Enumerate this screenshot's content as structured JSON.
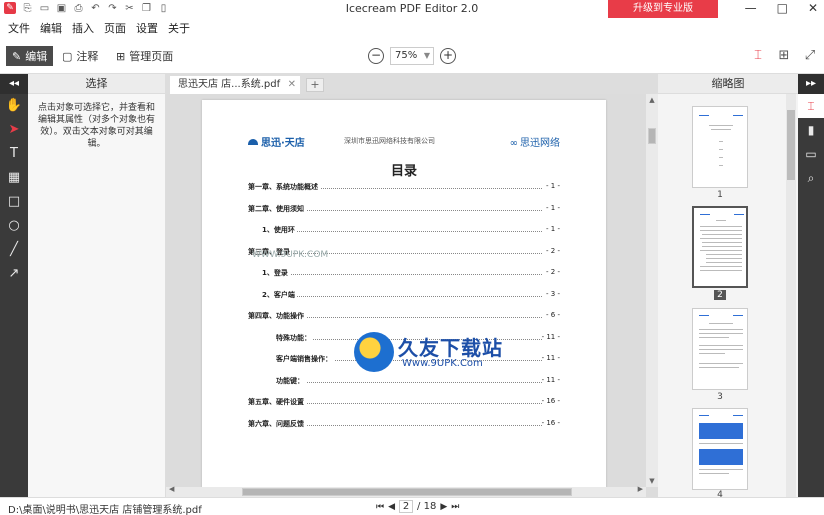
{
  "window": {
    "title": "Icecream PDF Editor 2.0",
    "upgrade_label": "升级到专业版",
    "minimize": "—",
    "maximize": "□",
    "close": "✕"
  },
  "menu": [
    "文件",
    "编辑",
    "插入",
    "页面",
    "设置",
    "关于"
  ],
  "toolbar": {
    "edit_label": "编辑",
    "annotate_label": "注释",
    "manage_label": "管理页面",
    "zoom_value": "75%"
  },
  "left_panel": {
    "collapse": "◂◂",
    "title": "选择",
    "description": "点击对象可选择它，并查看和编辑其属性（对多个对象也有效）。双击文本对象可对其编辑。",
    "tools": [
      "hand-icon",
      "select-arrow-icon",
      "text-tool-icon",
      "image-tool-icon",
      "rectangle-tool-icon",
      "ellipse-tool-icon",
      "line-tool-icon",
      "arrow-tool-icon"
    ]
  },
  "tab": {
    "name": "思迅天店 店...系统.pdf",
    "close": "✕",
    "add": "+"
  },
  "document": {
    "logo_left": "思迅·天店",
    "company": "深圳市思迅网络科技有限公司",
    "logo_right": "思迅网络",
    "toc_title": "目录",
    "toc": [
      {
        "title": "第一章、系统功能概述",
        "page": "- 1 -",
        "indent": 0
      },
      {
        "title": "第二章、使用须知",
        "page": "- 1 -",
        "indent": 0
      },
      {
        "title": "1、使用环",
        "page": "- 1 -",
        "indent": 1
      },
      {
        "title": "第三章、登录",
        "page": "- 2 -",
        "indent": 0
      },
      {
        "title": "1、登录",
        "page": "- 2 -",
        "indent": 1
      },
      {
        "title": "2、客户端",
        "page": "- 3 -",
        "indent": 1
      },
      {
        "title": "第四章、功能操作",
        "page": "- 6 -",
        "indent": 0
      },
      {
        "title": "特殊功能：",
        "page": "- 11 -",
        "indent": 2
      },
      {
        "title": "客户端销售操作：",
        "page": "- 11 -",
        "indent": 2
      },
      {
        "title": "功能键：",
        "page": "- 11 -",
        "indent": 2
      },
      {
        "title": "第五章、硬件设置",
        "page": "- 16 -",
        "indent": 0
      },
      {
        "title": "第六章、问题反馈",
        "page": "- 16 -",
        "indent": 0
      }
    ],
    "watermark_text": "久友下载站",
    "watermark_url": "Www.9UPK.Com",
    "watermark_url2": "WWW.9UPK.COM"
  },
  "thumbnails": {
    "title": "缩略图",
    "pages": [
      "1",
      "2",
      "3",
      "4"
    ],
    "selected": "2"
  },
  "right_panel": {
    "collapse": "▸▸",
    "tools": [
      "page-layout-icon",
      "bookmark-icon",
      "comment-icon",
      "search-icon"
    ]
  },
  "status": {
    "path": "D:\\桌面\\说明书\\思迅天店 店铺管理系统.pdf",
    "current_page": "2",
    "total": "/ 18"
  },
  "colors": {
    "accent": "#e83c48",
    "dark_panel": "#3a3a3a",
    "brand_blue": "#1b5faa"
  }
}
